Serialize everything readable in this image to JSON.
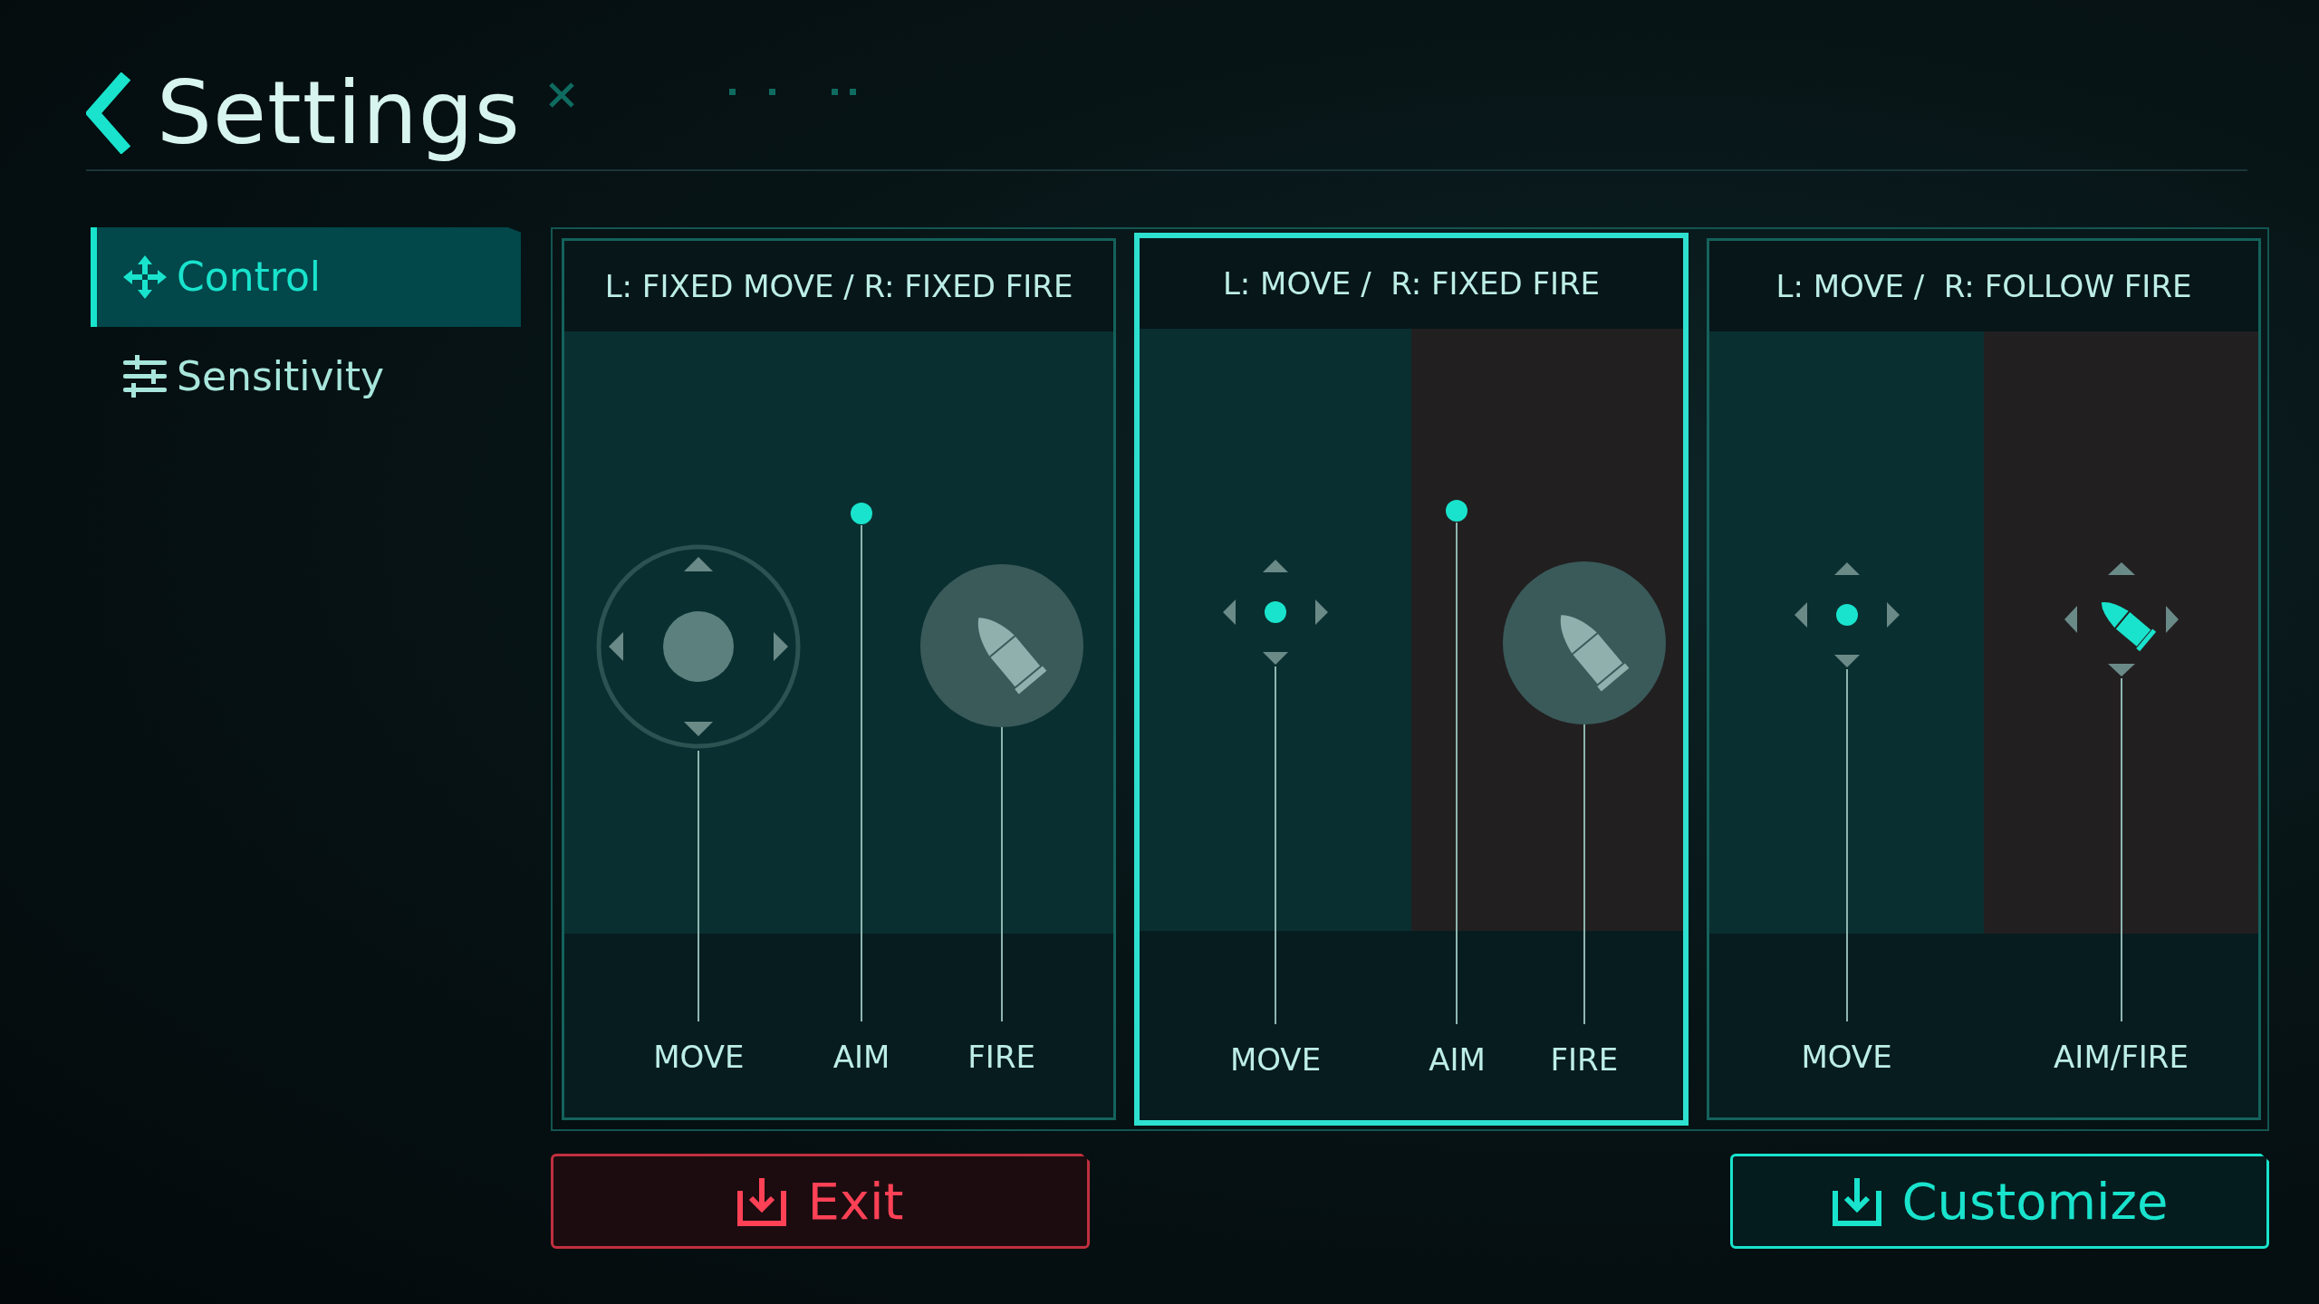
{
  "header": {
    "title": "Settings"
  },
  "sidebar": {
    "items": [
      {
        "label": "Control",
        "kind": "move",
        "selected": true
      },
      {
        "label": "Sensitivity",
        "kind": "sliders",
        "selected": false
      }
    ]
  },
  "modes": [
    {
      "title": "L: FIXED MOVE / R: FIXED FIRE",
      "selected": false,
      "zones": [
        {
          "kind": "teal",
          "controls": [
            {
              "kind": "joystick",
              "label": "MOVE"
            },
            {
              "kind": "aim",
              "label": "AIM"
            },
            {
              "kind": "fire",
              "label": "FIRE"
            }
          ]
        }
      ]
    },
    {
      "title": "L: MOVE /  R: FIXED FIRE",
      "selected": true,
      "zones": [
        {
          "kind": "teal",
          "controls": [
            {
              "kind": "dpad",
              "label": "MOVE"
            }
          ]
        },
        {
          "kind": "dark",
          "controls": [
            {
              "kind": "aim",
              "label": "AIM"
            },
            {
              "kind": "fire",
              "label": "FIRE"
            }
          ]
        }
      ]
    },
    {
      "title": "L: MOVE /  R: FOLLOW FIRE",
      "selected": false,
      "zones": [
        {
          "kind": "teal",
          "controls": [
            {
              "kind": "dpad",
              "label": "MOVE"
            }
          ]
        },
        {
          "kind": "dark",
          "controls": [
            {
              "kind": "aimfire",
              "label": "AIM/FIRE"
            }
          ]
        }
      ]
    }
  ],
  "buttons": [
    {
      "label": "Exit",
      "kind": "danger"
    },
    {
      "label": "Customize",
      "kind": "primary"
    }
  ]
}
